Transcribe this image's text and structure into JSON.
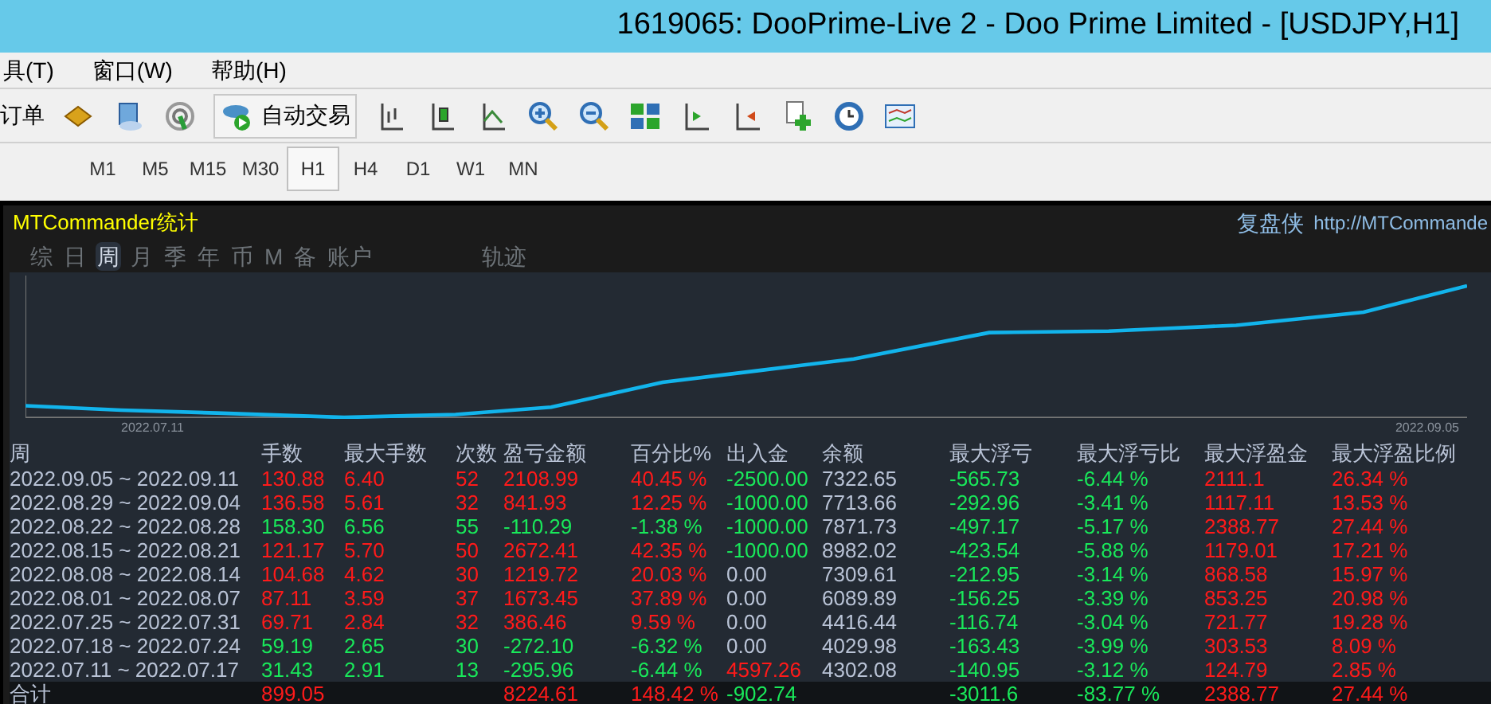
{
  "window": {
    "title": "1619065: DooPrime-Live 2 - Doo Prime Limited - [USDJPY,H1]"
  },
  "menu": [
    "具(T)",
    "窗口(W)",
    "帮助(H)"
  ],
  "toolbar": {
    "order_label": "订单",
    "autotrade_label": "自动交易"
  },
  "timeframes": [
    {
      "label": "M1",
      "selected": false
    },
    {
      "label": "M5",
      "selected": false
    },
    {
      "label": "M15",
      "selected": false
    },
    {
      "label": "M30",
      "selected": false
    },
    {
      "label": "H1",
      "selected": true
    },
    {
      "label": "H4",
      "selected": false
    },
    {
      "label": "D1",
      "selected": false
    },
    {
      "label": "W1",
      "selected": false
    },
    {
      "label": "MN",
      "selected": false
    }
  ],
  "panel": {
    "title": "MTCommander统计",
    "brand": "复盘侠",
    "url": "http://MTCommande",
    "tabs": [
      {
        "label": "综",
        "selected": false
      },
      {
        "label": "日",
        "selected": false
      },
      {
        "label": "周",
        "selected": true
      },
      {
        "label": "月",
        "selected": false
      },
      {
        "label": "季",
        "selected": false
      },
      {
        "label": "年",
        "selected": false
      },
      {
        "label": "币",
        "selected": false
      },
      {
        "label": "M",
        "selected": false
      },
      {
        "label": "备",
        "selected": false
      },
      {
        "label": "账户",
        "selected": false
      },
      {
        "label": "轨迹",
        "selected": false
      }
    ],
    "chart": {
      "start_label": "2022.07.11",
      "end_label": "2022.09.05"
    }
  },
  "table": {
    "columns": [
      {
        "label": "周",
        "kind": "neutral"
      },
      {
        "label": "手数",
        "kind": "result"
      },
      {
        "label": "最大手数",
        "kind": "result"
      },
      {
        "label": "次数",
        "kind": "result"
      },
      {
        "label": "盈亏金额",
        "kind": "result"
      },
      {
        "label": "百分比%",
        "kind": "result"
      },
      {
        "label": "出入金",
        "kind": "cash"
      },
      {
        "label": "余额",
        "kind": "neutral"
      },
      {
        "label": "最大浮亏",
        "kind": "loss"
      },
      {
        "label": "最大浮亏比",
        "kind": "loss"
      },
      {
        "label": "最大浮盈金",
        "kind": "gain"
      },
      {
        "label": "最大浮盈比例",
        "kind": "gain"
      }
    ],
    "rows": [
      {
        "profit": true,
        "withdrawal": true,
        "deposit": false,
        "cells": [
          "2022.09.05 ~ 2022.09.11",
          "130.88",
          "6.40",
          "52",
          "2108.99",
          "40.45 %",
          "-2500.00",
          "7322.65",
          "-565.73",
          "-6.44 %",
          "2111.1",
          "26.34 %"
        ]
      },
      {
        "profit": true,
        "withdrawal": true,
        "deposit": false,
        "cells": [
          "2022.08.29 ~ 2022.09.04",
          "136.58",
          "5.61",
          "32",
          "841.93",
          "12.25 %",
          "-1000.00",
          "7713.66",
          "-292.96",
          "-3.41 %",
          "1117.11",
          "13.53 %"
        ]
      },
      {
        "profit": false,
        "withdrawal": true,
        "deposit": false,
        "cells": [
          "2022.08.22 ~ 2022.08.28",
          "158.30",
          "6.56",
          "55",
          "-110.29",
          "-1.38 %",
          "-1000.00",
          "7871.73",
          "-497.17",
          "-5.17 %",
          "2388.77",
          "27.44 %"
        ]
      },
      {
        "profit": true,
        "withdrawal": true,
        "deposit": false,
        "cells": [
          "2022.08.15 ~ 2022.08.21",
          "121.17",
          "5.70",
          "50",
          "2672.41",
          "42.35 %",
          "-1000.00",
          "8982.02",
          "-423.54",
          "-5.88 %",
          "1179.01",
          "17.21 %"
        ]
      },
      {
        "profit": true,
        "withdrawal": false,
        "deposit": false,
        "cells": [
          "2022.08.08 ~ 2022.08.14",
          "104.68",
          "4.62",
          "30",
          "1219.72",
          "20.03 %",
          "0.00",
          "7309.61",
          "-212.95",
          "-3.14 %",
          "868.58",
          "15.97 %"
        ]
      },
      {
        "profit": true,
        "withdrawal": false,
        "deposit": false,
        "cells": [
          "2022.08.01 ~ 2022.08.07",
          "87.11",
          "3.59",
          "37",
          "1673.45",
          "37.89 %",
          "0.00",
          "6089.89",
          "-156.25",
          "-3.39 %",
          "853.25",
          "20.98 %"
        ]
      },
      {
        "profit": true,
        "withdrawal": false,
        "deposit": false,
        "cells": [
          "2022.07.25 ~ 2022.07.31",
          "69.71",
          "2.84",
          "32",
          "386.46",
          "9.59 %",
          "0.00",
          "4416.44",
          "-116.74",
          "-3.04 %",
          "721.77",
          "19.28 %"
        ]
      },
      {
        "profit": false,
        "withdrawal": false,
        "deposit": false,
        "cells": [
          "2022.07.18 ~ 2022.07.24",
          "59.19",
          "2.65",
          "30",
          "-272.10",
          "-6.32 %",
          "0.00",
          "4029.98",
          "-163.43",
          "-3.99 %",
          "303.53",
          "8.09 %"
        ]
      },
      {
        "profit": false,
        "withdrawal": false,
        "deposit": true,
        "cells": [
          "2022.07.11 ~ 2022.07.17",
          "31.43",
          "2.91",
          "13",
          "-295.96",
          "-6.44 %",
          "4597.26",
          "4302.08",
          "-140.95",
          "-3.12 %",
          "124.79",
          "2.85 %"
        ]
      }
    ],
    "total": {
      "profit": true,
      "withdrawal": true,
      "deposit": false,
      "cells": [
        "合计",
        "899.05",
        null,
        null,
        "8224.61",
        "148.42 %",
        "-902.74",
        null,
        "-3011.6",
        "-83.77 %",
        "2388.77",
        "27.44 %"
      ]
    }
  }
}
